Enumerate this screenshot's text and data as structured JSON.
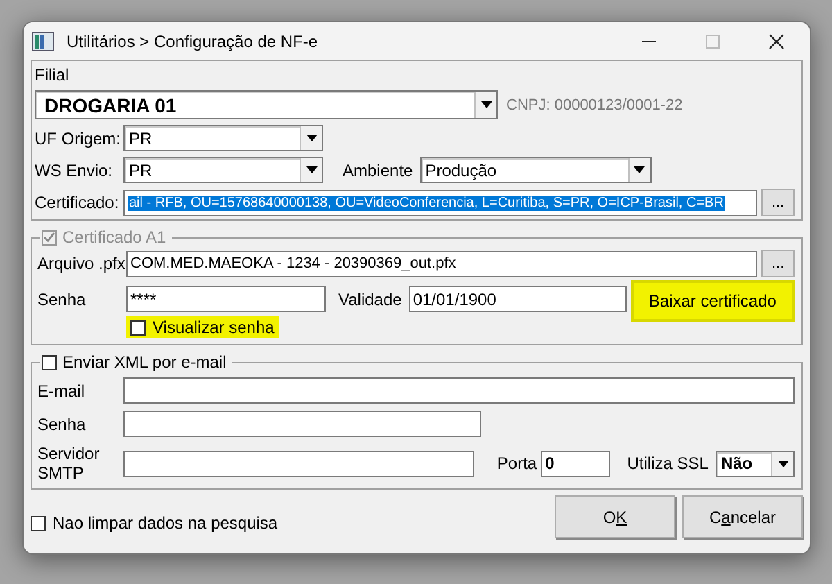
{
  "window": {
    "title": "Utilitários > Configuração de NF-e"
  },
  "filial": {
    "label": "Filial",
    "value": "DROGARIA 01",
    "cnpj": "CNPJ: 00000123/0001-22"
  },
  "uf_origem": {
    "label": "UF Origem:",
    "value": "PR"
  },
  "ws_envio": {
    "label": "WS Envio:",
    "value": "PR"
  },
  "ambiente": {
    "label": "Ambiente",
    "value": "Produção"
  },
  "certificado": {
    "label": "Certificado:",
    "value": "ail - RFB, OU=15768640000138, OU=VideoConferencia, L=Curitiba, S=PR, O=ICP-Brasil, C=BR",
    "selected": true,
    "button": "..."
  },
  "certificado_a1": {
    "title": "Certificado A1",
    "checked": true,
    "disabled": true,
    "arquivo": {
      "label": "Arquivo .pfx",
      "value": "COM.MED.MAEOKA - 1234 - 20390369_out.pfx",
      "button": "..."
    },
    "senha": {
      "label": "Senha",
      "value": "****"
    },
    "validade": {
      "label": "Validade",
      "value": "01/01/1900"
    },
    "download_button": {
      "label": "Baixar certificado",
      "highlighted": true
    },
    "show_password": {
      "label": "Visualizar senha",
      "checked": false,
      "highlighted": true
    }
  },
  "email_group": {
    "title": "Enviar XML por e-mail",
    "checked": false,
    "email": {
      "label": "E-mail"
    },
    "senha": {
      "label": "Senha"
    },
    "servidor": {
      "label": "Servidor SMTP"
    },
    "porta": {
      "label": "Porta",
      "value": "0"
    },
    "ssl": {
      "label": "Utiliza SSL",
      "value": "Não"
    }
  },
  "keep_data": {
    "label": "Nao limpar dados na pesquisa",
    "checked": false
  },
  "buttons": [
    {
      "before": "O",
      "key": "K"
    },
    {
      "before": "C",
      "key": "a",
      "after": "ncelar"
    }
  ]
}
